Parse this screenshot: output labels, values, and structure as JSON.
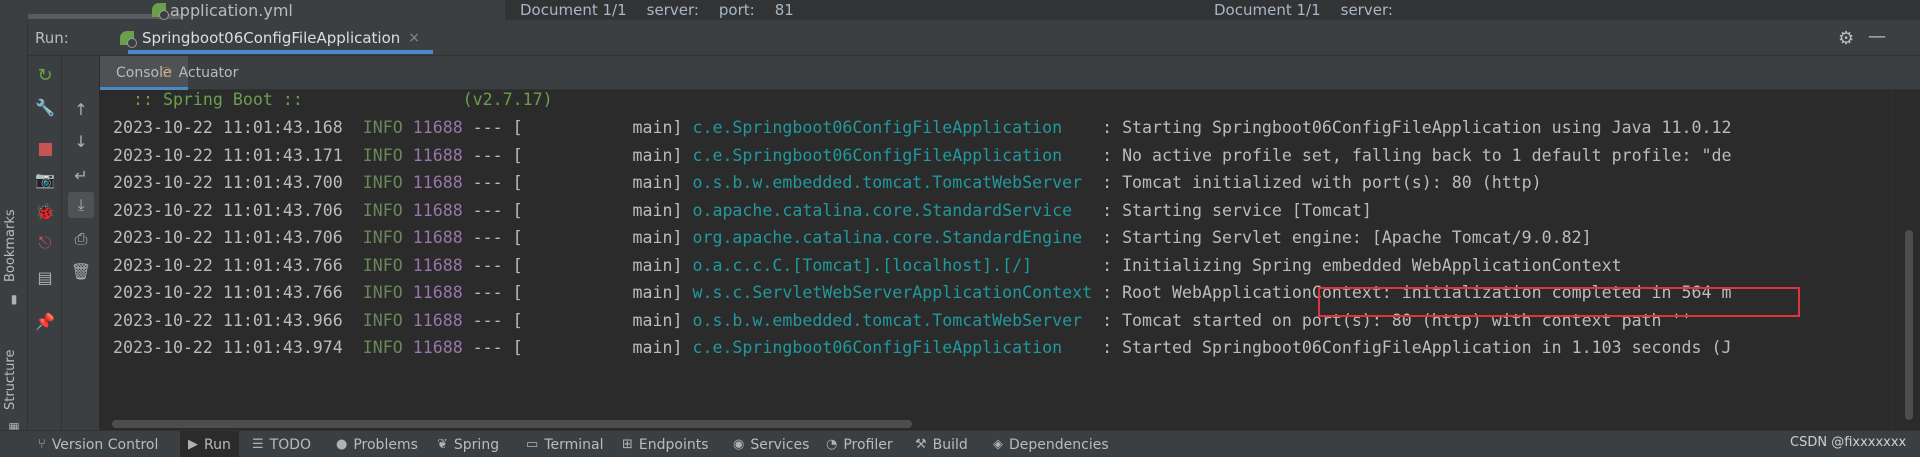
{
  "editor": {
    "file_name": "application.yml",
    "left_crumbs": [
      "Document 1/1",
      "server:",
      "port:",
      "81"
    ],
    "right_crumbs": [
      "Document 1/1",
      "server:"
    ]
  },
  "run_panel": {
    "label": "Run:",
    "tab_title": "Springboot06ConfigFileApplication",
    "close_glyph": "×",
    "settings_glyph": "⚙",
    "minimize_glyph": "—"
  },
  "side_labels": {
    "bookmarks": "Bookmarks",
    "structure": "Structure"
  },
  "console_tabs": [
    {
      "label": "Console"
    },
    {
      "label": "Actuator"
    }
  ],
  "console": {
    "banner": "  :: Spring Boot ::                (v2.7.17)",
    "lines": [
      {
        "ts": "2023-10-22 11:01:43.168",
        "lvl": "INFO",
        "pid": "11688",
        "mid": " --- [           main] ",
        "logger": "c.e.Springboot06ConfigFileApplication   ",
        "msg": " : Starting Springboot06ConfigFileApplication using Java 11.0.12"
      },
      {
        "ts": "2023-10-22 11:01:43.171",
        "lvl": "INFO",
        "pid": "11688",
        "mid": " --- [           main] ",
        "logger": "c.e.Springboot06ConfigFileApplication   ",
        "msg": " : No active profile set, falling back to 1 default profile: \"de"
      },
      {
        "ts": "2023-10-22 11:01:43.700",
        "lvl": "INFO",
        "pid": "11688",
        "mid": " --- [           main] ",
        "logger": "o.s.b.w.embedded.tomcat.TomcatWebServer ",
        "msg": " : Tomcat initialized with port(s): 80 (http)"
      },
      {
        "ts": "2023-10-22 11:01:43.706",
        "lvl": "INFO",
        "pid": "11688",
        "mid": " --- [           main] ",
        "logger": "o.apache.catalina.core.StandardService  ",
        "msg": " : Starting service [Tomcat]"
      },
      {
        "ts": "2023-10-22 11:01:43.706",
        "lvl": "INFO",
        "pid": "11688",
        "mid": " --- [           main] ",
        "logger": "org.apache.catalina.core.StandardEngine ",
        "msg": " : Starting Servlet engine: [Apache Tomcat/9.0.82]"
      },
      {
        "ts": "2023-10-22 11:01:43.766",
        "lvl": "INFO",
        "pid": "11688",
        "mid": " --- [           main] ",
        "logger": "o.a.c.c.C.[Tomcat].[localhost].[/]      ",
        "msg": " : Initializing Spring embedded WebApplicationContext"
      },
      {
        "ts": "2023-10-22 11:01:43.766",
        "lvl": "INFO",
        "pid": "11688",
        "mid": " --- [           main] ",
        "logger": "w.s.c.ServletWebServerApplicationContext",
        "msg": " : Root WebApplicationContext: initialization completed in 564 m"
      },
      {
        "ts": "2023-10-22 11:01:43.966",
        "lvl": "INFO",
        "pid": "11688",
        "mid": " --- [           main] ",
        "logger": "o.s.b.w.embedded.tomcat.TomcatWebServer ",
        "msg": " : Tomcat started on port(s): 80 (http) with context path ''"
      },
      {
        "ts": "2023-10-22 11:01:43.974",
        "lvl": "INFO",
        "pid": "11688",
        "mid": " --- [           main] ",
        "logger": "c.e.Springboot06ConfigFileApplication   ",
        "msg": " : Started Springboot06ConfigFileApplication in 1.103 seconds (J"
      }
    ]
  },
  "status_bar": {
    "items": [
      {
        "icon": "⑂",
        "label": "Version Control"
      },
      {
        "icon": "▶",
        "label": "Run"
      },
      {
        "icon": "☰",
        "label": "TODO"
      },
      {
        "icon": "●",
        "label": "Problems"
      },
      {
        "icon": "❦",
        "label": "Spring"
      },
      {
        "icon": "▭",
        "label": "Terminal"
      },
      {
        "icon": "⊞",
        "label": "Endpoints"
      },
      {
        "icon": "◉",
        "label": "Services"
      },
      {
        "icon": "◔",
        "label": "Profiler"
      },
      {
        "icon": "⚒",
        "label": "Build"
      },
      {
        "icon": "◈",
        "label": "Dependencies"
      }
    ],
    "watermark": "CSDN @fixxxxxxx"
  },
  "colors": {
    "background": "#2b2b2b",
    "panel": "#3c3f41",
    "accent": "#4a88c7",
    "spring_green": "#6a9f4b",
    "logger_cyan": "#20999d",
    "pid_purple": "#9876aa",
    "highlight_red": "#e0343a"
  }
}
